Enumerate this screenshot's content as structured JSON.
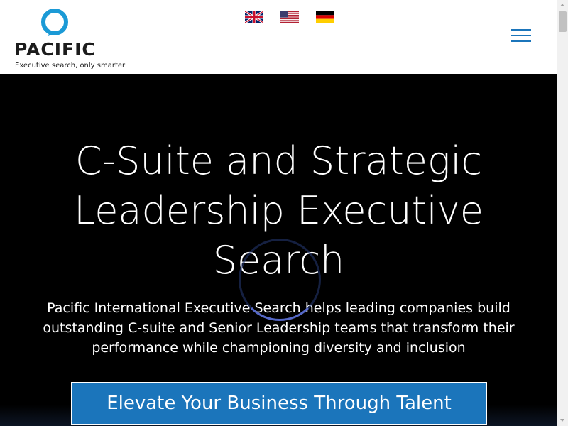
{
  "brand": {
    "name": "PACIFIC",
    "tagline": "Executive search, only smarter",
    "accent_color": "#1b75bb"
  },
  "language_flags": [
    {
      "icon": "uk-flag-icon",
      "language": "English (UK)"
    },
    {
      "icon": "us-flag-icon",
      "language": "English (US)"
    },
    {
      "icon": "germany-flag-icon",
      "language": "German"
    }
  ],
  "menu": {
    "icon": "hamburger-menu-icon"
  },
  "hero": {
    "title_lines": [
      "C-Suite and Strategic",
      "Leadership Executive",
      "Search"
    ],
    "subtitle": "Pacific International Executive Search helps leading companies build outstanding C-suite and Senior Leadership teams that transform their performance while championing diversity and inclusion",
    "cta_label": "Elevate Your Business Through Talent",
    "background_color": "#000000"
  }
}
